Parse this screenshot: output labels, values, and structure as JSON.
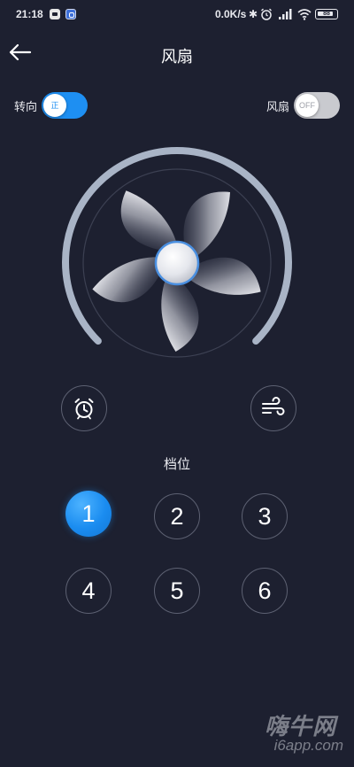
{
  "status_bar": {
    "time": "21:18",
    "network_speed": "0.0K/s",
    "battery_level": "88",
    "icons": [
      "message-app-icon",
      "security-app-icon",
      "bluetooth-icon",
      "alarm-icon",
      "signal-icon",
      "wifi-icon",
      "battery-icon"
    ]
  },
  "header": {
    "title": "风扇",
    "back_icon": "arrow-left-icon"
  },
  "toggles": {
    "direction": {
      "label": "转向",
      "state": "on",
      "knob_text": "正"
    },
    "fan": {
      "label": "风扇",
      "state": "off",
      "knob_text": "OFF"
    }
  },
  "fan": {
    "blade_count": 5,
    "icon": "fan-icon"
  },
  "actions": {
    "timer_icon": "alarm-clock-icon",
    "wind_mode_icon": "wind-icon"
  },
  "gear": {
    "label": "档位",
    "options": [
      "1",
      "2",
      "3",
      "4",
      "5",
      "6"
    ],
    "selected": "1"
  },
  "watermark": {
    "brand": "嗨牛网",
    "url": "i6app.com"
  },
  "colors": {
    "background": "#1d2030",
    "accent": "#1e8ff2",
    "ring": "#a9b4c6",
    "outline": "#5d6172"
  }
}
